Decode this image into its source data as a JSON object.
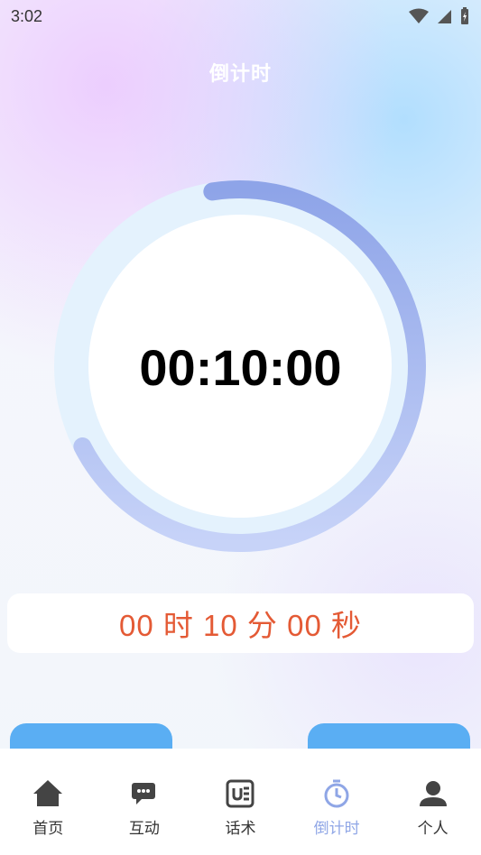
{
  "status_bar": {
    "time": "3:02"
  },
  "header": {
    "title": "倒计时"
  },
  "timer": {
    "display": "00:10:00",
    "detail": "00 时 10 分 00 秒",
    "progress": 0.7
  },
  "buttons": [
    {
      "label": ""
    },
    {
      "label": ""
    }
  ],
  "nav": [
    {
      "label": "首页",
      "icon": "home-icon",
      "active": false
    },
    {
      "label": "互动",
      "icon": "chat-icon",
      "active": false
    },
    {
      "label": "话术",
      "icon": "script-icon",
      "active": false
    },
    {
      "label": "倒计时",
      "icon": "timer-icon",
      "active": true
    },
    {
      "label": "个人",
      "icon": "person-icon",
      "active": false
    }
  ],
  "colors": {
    "accent": "#8fa6e6",
    "button": "#5aaef3",
    "time_text": "#e45a35"
  }
}
